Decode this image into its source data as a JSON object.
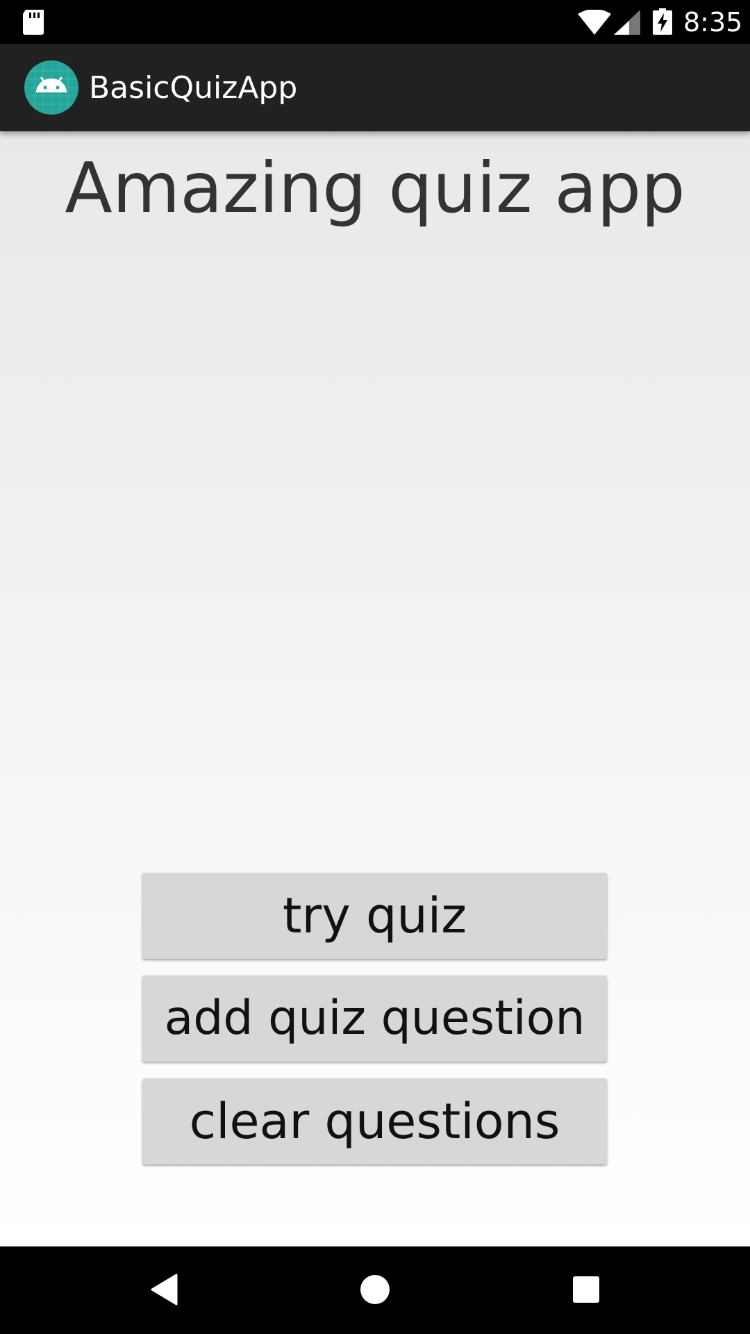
{
  "status_bar": {
    "time": "8:35",
    "icons": [
      "sd-card-icon",
      "wifi-icon",
      "signal-icon",
      "battery-charging-icon"
    ]
  },
  "app_bar": {
    "title": "BasicQuizApp",
    "icon": "android-launcher-icon",
    "icon_color": "#26a69a"
  },
  "main": {
    "headline": "Amazing quiz app",
    "buttons": {
      "try_quiz": "try quiz",
      "add_question": "add quiz question",
      "clear_questions": "clear questions"
    }
  },
  "nav_bar": {
    "icons": [
      "back-icon",
      "home-icon",
      "recents-icon"
    ]
  },
  "colors": {
    "app_bar": "#212121",
    "button": "#d6d7d7",
    "headline_text": "#333333",
    "system_bars": "#000000"
  }
}
